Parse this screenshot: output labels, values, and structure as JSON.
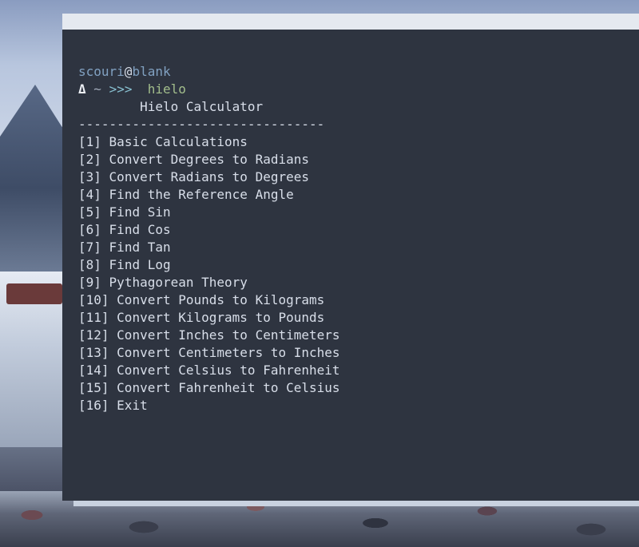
{
  "prompt": {
    "user": "scouri",
    "at": "@",
    "host": "blank",
    "delta": "Δ",
    "cwd": "~",
    "arrows": ">>>",
    "command": "hielo"
  },
  "app": {
    "title": "Hielo Calculator",
    "separator": "--------------------------------"
  },
  "menu": [
    {
      "number": "[1]",
      "label": "Basic Calculations"
    },
    {
      "number": "[2]",
      "label": "Convert Degrees to Radians"
    },
    {
      "number": "[3]",
      "label": "Convert Radians to Degrees"
    },
    {
      "number": "[4]",
      "label": "Find the Reference Angle"
    },
    {
      "number": "[5]",
      "label": "Find Sin"
    },
    {
      "number": "[6]",
      "label": "Find Cos"
    },
    {
      "number": "[7]",
      "label": "Find Tan"
    },
    {
      "number": "[8]",
      "label": "Find Log"
    },
    {
      "number": "[9]",
      "label": "Pythagorean Theory"
    },
    {
      "number": "[10]",
      "label": "Convert Pounds to Kilograms"
    },
    {
      "number": "[11]",
      "label": "Convert Kilograms to Pounds"
    },
    {
      "number": "[12]",
      "label": "Convert Inches to Centimeters"
    },
    {
      "number": "[13]",
      "label": "Convert Centimeters to Inches"
    },
    {
      "number": "[14]",
      "label": "Convert Celsius to Fahrenheit"
    },
    {
      "number": "[15]",
      "label": "Convert Fahrenheit to Celsius"
    },
    {
      "number": "[16]",
      "label": "Exit"
    }
  ],
  "colors": {
    "terminal_bg": "#2e3440",
    "titlebar_bg": "#e5e9f0",
    "text": "#d8dee9",
    "user_host": "#81a1c1",
    "command": "#a3be8c",
    "prompt_arrows": "#88c0d0"
  }
}
